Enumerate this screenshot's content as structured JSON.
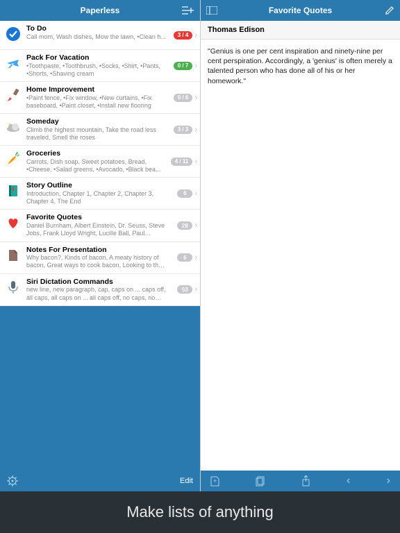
{
  "leftNav": {
    "title": "Paperless"
  },
  "rightNav": {
    "title": "Favorite Quotes"
  },
  "lists": [
    {
      "title": "To Do",
      "sub": "Call mom, Wash dishes, Mow the lawn, •Clean h...",
      "badge": "3 / 4",
      "badgeColor": "#e53935"
    },
    {
      "title": "Pack For Vacation",
      "sub": "•Toothpaste, •Toothbrush, •Socks, •Shirt, •Pants, •Shorts, •Shaving cream",
      "badge": "0 / 7",
      "badgeColor": "#4caf50"
    },
    {
      "title": "Home Improvement",
      "sub": "•Paint fence, •Fix window, •New curtains, •Fix baseboard, •Paint closet, •Install new flooring",
      "badge": "0 / 6",
      "badgeColor": "#c7c7cc"
    },
    {
      "title": "Someday",
      "sub": "Climb the highest mountain, Take the road less traveled, Smell the roses",
      "badge": "3 / 3",
      "badgeColor": "#c7c7cc"
    },
    {
      "title": "Groceries",
      "sub": "Carrots, Dish soap, Sweet potatoes, Bread, •Cheese, •Salad greens, •Avocado, •Black bea...",
      "badge": "4 / 11",
      "badgeColor": "#c7c7cc"
    },
    {
      "title": "Story Outline",
      "sub": "Introduction, Chapter 1, Chapter 2, Chapter 3, Chapter 4, The End",
      "badge": "6",
      "badgeColor": "#c7c7cc"
    },
    {
      "title": "Favorite Quotes",
      "sub": "Daniel Burnham, Albert Einstein, Dr. Seuss, Steve Jobs, Frank Lloyd Wright, Lucille Ball, Paul Arden,...",
      "badge": "28",
      "badgeColor": "#c7c7cc"
    },
    {
      "title": "Notes For Presentation",
      "sub": "Why bacon?, Kinds of bacon, A meaty history of bacon, Great ways to cook bacon, Looking to the f...",
      "badge": "6",
      "badgeColor": "#c7c7cc"
    },
    {
      "title": "Siri Dictation Commands",
      "sub": "new line, new paragraph, cap, caps on ... caps off, all caps, all caps on ... all caps off, no caps, no ca...",
      "badge": "53",
      "badgeColor": "#c7c7cc"
    }
  ],
  "leftToolbar": {
    "edit": "Edit"
  },
  "detail": {
    "author": "Thomas Edison",
    "quote": "\"Genius is one per cent inspiration and ninety-nine per cent perspiration. Accordingly, a  'genius' is often merely a talented person who has done all of his or her homework.\""
  },
  "caption": "Make lists of anything"
}
